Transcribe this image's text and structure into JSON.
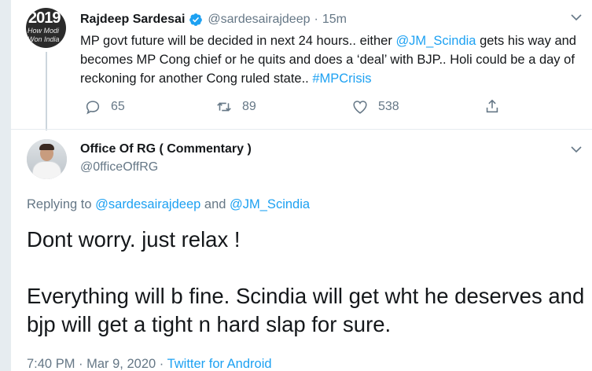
{
  "original_tweet": {
    "avatar_text_large": "2019",
    "avatar_text_line1": "How Modi",
    "avatar_text_line2": "Won India",
    "author_name": "Rajdeep Sardesai",
    "author_handle": "@sardesairajdeep",
    "separator": "·",
    "timestamp": "15m",
    "text_part1": "MP govt future will be decided in next 24 hours.. either ",
    "mention": "@JM_Scindia",
    "text_part2": " gets his way and becomes MP Cong chief or he quits and does a ‘deal’ with BJP.. Holi could be a day of reckoning for another Cong ruled state.. ",
    "hashtag": "#MPCrisis",
    "replies_count": "65",
    "retweets_count": "89",
    "likes_count": "538"
  },
  "reply_tweet": {
    "author_name": "Office Of RG ( Commentary )",
    "author_handle": "@0fficeOffRG",
    "replying_prefix": "Replying to ",
    "replying_to_1": "@sardesairajdeep",
    "replying_and": " and ",
    "replying_to_2": "@JM_Scindia",
    "body_line1": "Dont worry. just relax !",
    "body_line2": "Everything will b fine. Scindia will get wht he deserves and bjp will get a tight n hard slap for sure.",
    "time": "7:40 PM",
    "date": "Mar 9, 2020",
    "meta_separator": " · ",
    "source": "Twitter for Android"
  },
  "colors": {
    "accent": "#1da1f2",
    "secondary_text": "#657786",
    "primary_text": "#14171a",
    "border": "#e6ecf0"
  }
}
